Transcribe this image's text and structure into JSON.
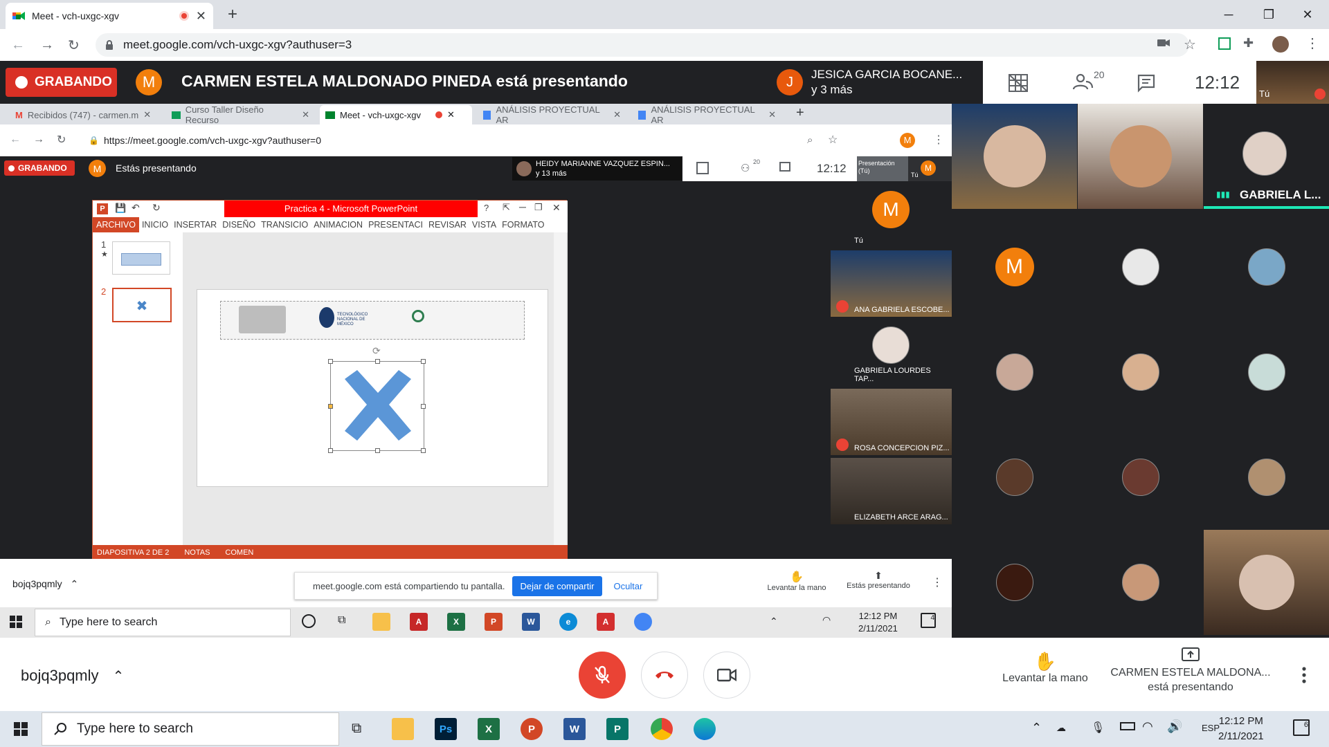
{
  "browser": {
    "tab_title": "Meet - vch-uxgc-xgv",
    "url": "meet.google.com/vch-uxgc-xgv?authuser=3"
  },
  "meet_top": {
    "recording_label": "GRABANDO",
    "presenter_avatar": "M",
    "presenting_text": "CARMEN ESTELA MALDONADO PINEDA está presentando",
    "speaker_avatar": "J",
    "speaker_name": "JESICA GARCIA BOCANE...",
    "speaker_more": "y 3 más",
    "participants_count": "20",
    "time": "12:12",
    "self_label": "Tú"
  },
  "shared_screen": {
    "tabs": [
      {
        "label": "Recibidos (747) - carmen.m"
      },
      {
        "label": "Curso Taller Diseño Recurso"
      },
      {
        "label": "Meet - vch-uxgc-xgv"
      },
      {
        "label": "ANÁLISIS PROYECTUAL AR"
      },
      {
        "label": "ANÁLISIS PROYECTUAL AR"
      }
    ],
    "url": "https://meet.google.com/vch-uxgc-xgv?authuser=0",
    "recording_label": "GRABANDO",
    "presenter_avatar": "M",
    "presenting_text": "Estás presentando",
    "speaker_name": "HEIDY MARIANNE VAZQUEZ ESPIN...",
    "speaker_more": "y 13 más",
    "participants_count": "20",
    "time": "12:12",
    "pres_tile_label": "Presentación (Tú)",
    "pres_tile_self": "Tú",
    "powerpoint": {
      "title": "Practica 4 -  Microsoft PowerPoint",
      "ribbon_tabs": [
        "ARCHIVO",
        "INICIO",
        "INSERTAR",
        "DISEÑO",
        "TRANSICIO",
        "ANIMACION",
        "PRESENTACI",
        "REVISAR",
        "VISTA",
        "FORMATO"
      ],
      "slide_numbers": [
        "1",
        "2"
      ],
      "status_slide": "DIAPOSITIVA 2 DE 2",
      "status_notes": "NOTAS",
      "status_comments": "COMEN",
      "logo_text": "TECNOLÓGICO NACIONAL DE MÉXICO"
    },
    "share_bar": {
      "text": "meet.google.com está compartiendo tu pantalla.",
      "stop_label": "Dejar de compartir",
      "hide_label": "Ocultar"
    },
    "meeting_code": "bojq3pqmly",
    "raise_hand": "Levantar la mano",
    "presenting_btn": "Estás presentando",
    "taskbar_search": "Type here to search",
    "clock_time": "12:12 PM",
    "clock_date": "2/11/2021",
    "notif_count": "4",
    "participants": [
      {
        "label": "Tú",
        "avatar": "M"
      },
      {
        "label": "ANA GABRIELA ESCOBE..."
      },
      {
        "label": "GABRIELA LOURDES TAP..."
      },
      {
        "label": "ROSA CONCEPCION PIZ..."
      },
      {
        "label": "ELIZABETH ARCE ARAG..."
      }
    ]
  },
  "grid": {
    "named_tile": "GABRIELA L...",
    "avatar_letter": "M"
  },
  "bottom_bar": {
    "meeting_code": "bojq3pqmly",
    "raise_hand": "Levantar la mano",
    "presenting_line1": "CARMEN ESTELA MALDONA...",
    "presenting_line2": "está presentando"
  },
  "taskbar": {
    "search_placeholder": "Type here to search",
    "language": "ESP",
    "clock_time": "12:12 PM",
    "clock_date": "2/11/2021",
    "notif_count": "6"
  },
  "colors": {
    "recording_red": "#d93025",
    "avatar_orange": "#f27f0c",
    "meet_dark": "#202124",
    "accent_blue": "#1a73e8",
    "powerpoint_orange": "#d24726",
    "active_teal": "#1de9b6"
  }
}
